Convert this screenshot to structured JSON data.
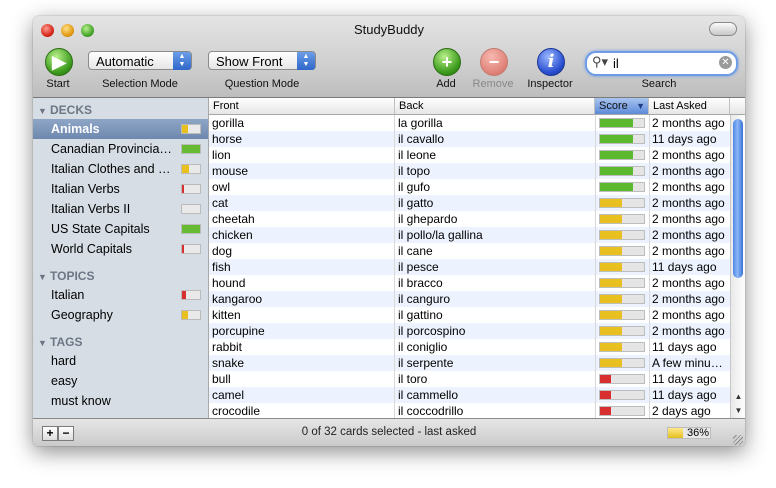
{
  "app": {
    "title": "StudyBuddy"
  },
  "toolbar": {
    "start_label": "Start",
    "selection_mode_value": "Automatic",
    "selection_mode_label": "Selection Mode",
    "question_mode_value": "Show Front",
    "question_mode_label": "Question Mode",
    "add_label": "Add",
    "remove_label": "Remove",
    "inspector_label": "Inspector",
    "search_value": "il",
    "search_label": "Search"
  },
  "sidebar": {
    "decks_heading": "DECKS",
    "decks": [
      {
        "label": "Animals",
        "score": 0.35,
        "color": "#e8c020",
        "selected": true
      },
      {
        "label": "Canadian Provincial Capitals",
        "display": "Canadian Provincia…",
        "score": 1.0,
        "color": "#66bb33"
      },
      {
        "label": "Italian Clothes and …",
        "score": 0.4,
        "color": "#e8c020"
      },
      {
        "label": "Italian Verbs",
        "score": 0.1,
        "color": "#d83030"
      },
      {
        "label": "Italian Verbs II",
        "score": 0.0,
        "color": "#d83030"
      },
      {
        "label": "US State Capitals",
        "score": 1.0,
        "color": "#66bb33"
      },
      {
        "label": "World Capitals",
        "score": 0.1,
        "color": "#d83030"
      }
    ],
    "topics_heading": "TOPICS",
    "topics": [
      {
        "label": "Italian",
        "score": 0.2,
        "color": "#d83030"
      },
      {
        "label": "Geography",
        "score": 0.35,
        "color": "#e8c020"
      }
    ],
    "tags_heading": "TAGS",
    "tags": [
      {
        "label": "hard"
      },
      {
        "label": "easy"
      },
      {
        "label": "must know"
      }
    ]
  },
  "table": {
    "columns": [
      "Front",
      "Back",
      "Score",
      "Last Asked"
    ],
    "sort_indicator": "▼",
    "rows": [
      {
        "front": "gorilla",
        "back": "la gorilla",
        "score": 0.75,
        "color": "#5cb82c",
        "last": "2 months ago"
      },
      {
        "front": "horse",
        "back": "il cavallo",
        "score": 0.75,
        "color": "#5cb82c",
        "last": "11 days ago"
      },
      {
        "front": "lion",
        "back": "il leone",
        "score": 0.75,
        "color": "#5cb82c",
        "last": "2 months ago"
      },
      {
        "front": "mouse",
        "back": "il topo",
        "score": 0.75,
        "color": "#5cb82c",
        "last": "2 months ago"
      },
      {
        "front": "owl",
        "back": "il gufo",
        "score": 0.75,
        "color": "#5cb82c",
        "last": "2 months ago"
      },
      {
        "front": "cat",
        "back": "il gatto",
        "score": 0.5,
        "color": "#e8c020",
        "last": "2 months ago"
      },
      {
        "front": "cheetah",
        "back": "il ghepardo",
        "score": 0.5,
        "color": "#e8c020",
        "last": "2 months ago"
      },
      {
        "front": "chicken",
        "back": "il pollo/la gallina",
        "score": 0.5,
        "color": "#e8c020",
        "last": "2 months ago"
      },
      {
        "front": "dog",
        "back": "il cane",
        "score": 0.5,
        "color": "#e8c020",
        "last": "2 months ago"
      },
      {
        "front": "fish",
        "back": "il pesce",
        "score": 0.5,
        "color": "#e8c020",
        "last": "11 days ago"
      },
      {
        "front": "hound",
        "back": "il bracco",
        "score": 0.5,
        "color": "#e8c020",
        "last": "2 months ago"
      },
      {
        "front": "kangaroo",
        "back": "il canguro",
        "score": 0.5,
        "color": "#e8c020",
        "last": "2 months ago"
      },
      {
        "front": "kitten",
        "back": "il gattino",
        "score": 0.5,
        "color": "#e8c020",
        "last": "2 months ago"
      },
      {
        "front": "porcupine",
        "back": "il porcospino",
        "score": 0.5,
        "color": "#e8c020",
        "last": "2 months ago"
      },
      {
        "front": "rabbit",
        "back": "il coniglio",
        "score": 0.5,
        "color": "#e8c020",
        "last": "11 days ago"
      },
      {
        "front": "snake",
        "back": "il serpente",
        "score": 0.5,
        "color": "#e8c020",
        "last": "A few minu…"
      },
      {
        "front": "bull",
        "back": "il toro",
        "score": 0.25,
        "color": "#d83030",
        "last": "11 days ago"
      },
      {
        "front": "camel",
        "back": "il cammello",
        "score": 0.25,
        "color": "#d83030",
        "last": "11 days ago"
      },
      {
        "front": "crocodile",
        "back": "il coccodrillo",
        "score": 0.25,
        "color": "#d83030",
        "last": "2 days ago"
      }
    ]
  },
  "status": {
    "text": "0 of 32 cards selected - last asked",
    "add_symbol": "+",
    "remove_symbol": "−",
    "progress": 0.36,
    "progress_label": "36%"
  },
  "colors": {
    "accent": "#5d8ad8",
    "selection": "#7890b4",
    "alt_row": "#edf3fe"
  }
}
